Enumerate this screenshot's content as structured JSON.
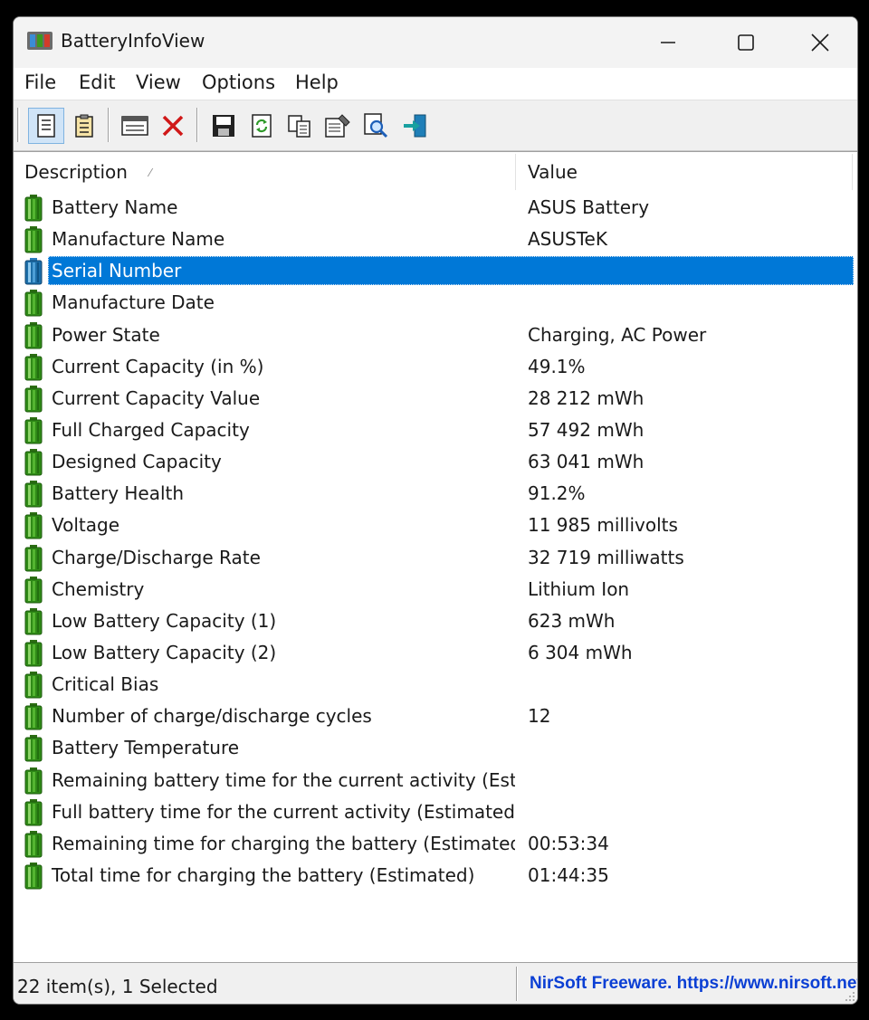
{
  "window": {
    "title": "BatteryInfoView"
  },
  "menu": [
    "File",
    "Edit",
    "View",
    "Options",
    "Help"
  ],
  "toolbar": [
    {
      "icon": "html-report-icon",
      "pressed": true
    },
    {
      "icon": "properties-report-icon",
      "pressed": false
    },
    {
      "icon": "battery-log-icon",
      "pressed": false
    },
    {
      "icon": "delete-icon",
      "pressed": false
    },
    {
      "icon": "save-icon",
      "pressed": false
    },
    {
      "icon": "refresh-icon",
      "pressed": false
    },
    {
      "icon": "copy-icon",
      "pressed": false
    },
    {
      "icon": "properties-icon",
      "pressed": false
    },
    {
      "icon": "find-icon",
      "pressed": false
    },
    {
      "icon": "exit-icon",
      "pressed": false
    }
  ],
  "columns": {
    "description": "Description",
    "value": "Value"
  },
  "rows": [
    {
      "description": "Battery Name",
      "value": "ASUS Battery"
    },
    {
      "description": "Manufacture Name",
      "value": "ASUSTeK"
    },
    {
      "description": "Serial Number",
      "value": "",
      "selected": true
    },
    {
      "description": "Manufacture Date",
      "value": ""
    },
    {
      "description": "Power State",
      "value": "Charging, AC Power"
    },
    {
      "description": "Current Capacity (in %)",
      "value": "49.1%"
    },
    {
      "description": "Current Capacity Value",
      "value": "28 212 mWh"
    },
    {
      "description": "Full Charged Capacity",
      "value": "57 492 mWh"
    },
    {
      "description": "Designed Capacity",
      "value": "63 041 mWh"
    },
    {
      "description": "Battery Health",
      "value": "91.2%"
    },
    {
      "description": "Voltage",
      "value": "11 985 millivolts"
    },
    {
      "description": "Charge/Discharge Rate",
      "value": "32 719 milliwatts"
    },
    {
      "description": "Chemistry",
      "value": "Lithium Ion"
    },
    {
      "description": "Low Battery Capacity (1)",
      "value": "623 mWh"
    },
    {
      "description": "Low Battery Capacity (2)",
      "value": "6 304 mWh"
    },
    {
      "description": "Critical Bias",
      "value": ""
    },
    {
      "description": "Number of charge/discharge cycles",
      "value": "12"
    },
    {
      "description": "Battery Temperature",
      "value": ""
    },
    {
      "description": "Remaining battery time for the current activity (Est...",
      "value": ""
    },
    {
      "description": "Full battery time for the current activity (Estimated)",
      "value": ""
    },
    {
      "description": "Remaining time for charging the battery (Estimated)",
      "value": "00:53:34"
    },
    {
      "description": "Total  time for charging the battery (Estimated)",
      "value": "01:44:35"
    }
  ],
  "status": {
    "items": "22 item(s), 1 Selected",
    "link": "NirSoft Freeware. https://www.nirsoft.net"
  },
  "colors": {
    "selection": "#0078d7",
    "battery": "#3a9a1e",
    "link": "#0b3fd4"
  }
}
